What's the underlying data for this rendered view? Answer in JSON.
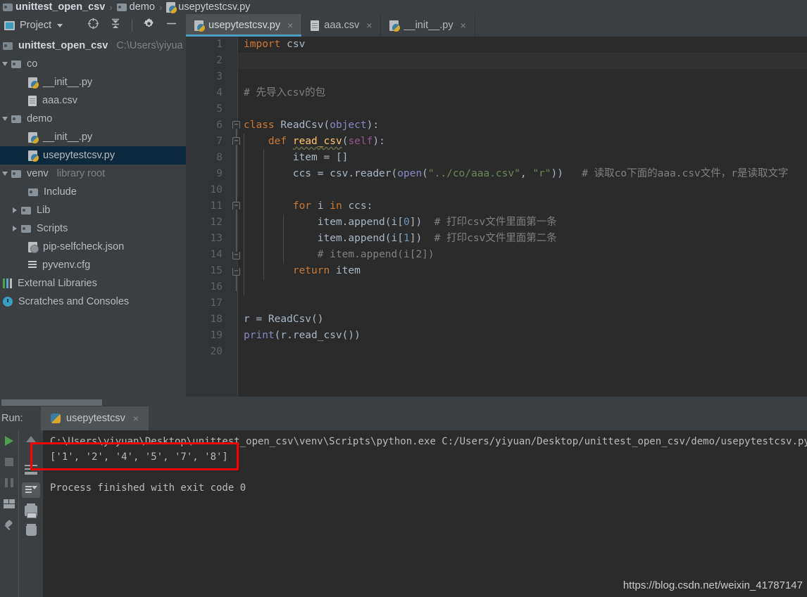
{
  "breadcrumb": {
    "items": [
      {
        "label": "unittest_open_csv",
        "icon": "folder-icon",
        "bold": true
      },
      {
        "label": "demo",
        "icon": "folder-icon",
        "bold": false
      },
      {
        "label": "usepytestcsv.py",
        "icon": "python-file-icon",
        "bold": false
      }
    ],
    "separator": "›"
  },
  "project_panel": {
    "title": "Project",
    "caret": "chevron-down-icon",
    "toolbar": [
      {
        "name": "locate-icon",
        "label": "Select Opened File"
      },
      {
        "name": "collapse-all-icon",
        "label": "Collapse All"
      },
      {
        "name": "gear-icon",
        "label": "Settings"
      },
      {
        "name": "hide-icon",
        "label": "Hide"
      }
    ],
    "tree": [
      {
        "label": "unittest_open_csv",
        "hint": "C:\\Users\\yiyua",
        "icon": "folder-icon",
        "depth": 0,
        "twisty": "",
        "bold": true,
        "selected": false
      },
      {
        "label": "co",
        "hint": "",
        "icon": "folder-icon",
        "depth": 1,
        "twisty": "down",
        "bold": false,
        "selected": false
      },
      {
        "label": "__init__.py",
        "hint": "",
        "icon": "python-file-icon",
        "depth": 2,
        "twisty": "",
        "bold": false,
        "selected": false
      },
      {
        "label": "aaa.csv",
        "hint": "",
        "icon": "csv-file-icon",
        "depth": 2,
        "twisty": "",
        "bold": false,
        "selected": false
      },
      {
        "label": "demo",
        "hint": "",
        "icon": "folder-icon",
        "depth": 1,
        "twisty": "down",
        "bold": false,
        "selected": false
      },
      {
        "label": "__init__.py",
        "hint": "",
        "icon": "python-file-icon",
        "depth": 2,
        "twisty": "",
        "bold": false,
        "selected": false
      },
      {
        "label": "usepytestcsv.py",
        "hint": "",
        "icon": "python-file-icon",
        "depth": 2,
        "twisty": "",
        "bold": false,
        "selected": true
      },
      {
        "label": "venv",
        "hint": "library root",
        "icon": "folder-icon",
        "depth": 1,
        "twisty": "down",
        "bold": false,
        "selected": false
      },
      {
        "label": "Include",
        "hint": "",
        "icon": "folder-icon",
        "depth": 2,
        "twisty": "",
        "bold": false,
        "selected": false
      },
      {
        "label": "Lib",
        "hint": "",
        "icon": "folder-icon",
        "depth": 2,
        "twisty": "right",
        "bold": false,
        "selected": false
      },
      {
        "label": "Scripts",
        "hint": "",
        "icon": "folder-icon",
        "depth": 2,
        "twisty": "right",
        "bold": false,
        "selected": false
      },
      {
        "label": "pip-selfcheck.json",
        "hint": "",
        "icon": "json-file-icon",
        "depth": 2,
        "twisty": "",
        "bold": false,
        "selected": false
      },
      {
        "label": "pyvenv.cfg",
        "hint": "",
        "icon": "cfg-file-icon",
        "depth": 2,
        "twisty": "",
        "bold": false,
        "selected": false
      },
      {
        "label": "External Libraries",
        "hint": "",
        "icon": "external-libraries-icon",
        "depth": 0,
        "twisty": "",
        "bold": false,
        "selected": false
      },
      {
        "label": "Scratches and Consoles",
        "hint": "",
        "icon": "scratches-icon",
        "depth": 0,
        "twisty": "",
        "bold": false,
        "selected": false
      }
    ]
  },
  "editor_tabs": [
    {
      "label": "usepytestcsv.py",
      "icon": "python-file-icon",
      "active": true,
      "close": "×"
    },
    {
      "label": "aaa.csv",
      "icon": "csv-file-icon",
      "active": false,
      "close": "×"
    },
    {
      "label": "__init__.py",
      "icon": "python-file-icon",
      "active": false,
      "close": "×"
    }
  ],
  "editor": {
    "line_numbers": [
      "1",
      "2",
      "3",
      "4",
      "5",
      "6",
      "7",
      "8",
      "9",
      "10",
      "11",
      "12",
      "13",
      "14",
      "15",
      "16",
      "17",
      "18",
      "19",
      "20"
    ],
    "lines": [
      {
        "n": 1,
        "text": "import csv"
      },
      {
        "n": 2,
        "text": ""
      },
      {
        "n": 3,
        "text": ""
      },
      {
        "n": 4,
        "text": "# 先导入csv的包"
      },
      {
        "n": 5,
        "text": ""
      },
      {
        "n": 6,
        "text": "class ReadCsv(object):"
      },
      {
        "n": 7,
        "text": "    def read_csv(self):"
      },
      {
        "n": 8,
        "text": "        item = []"
      },
      {
        "n": 9,
        "text": "        ccs = csv.reader(open(\"../co/aaa.csv\", \"r\"))   # 读取co下面的aaa.csv文件，r是读取文字"
      },
      {
        "n": 10,
        "text": ""
      },
      {
        "n": 11,
        "text": "        for i in ccs:"
      },
      {
        "n": 12,
        "text": "            item.append(i[0])  # 打印csv文件里面第一条"
      },
      {
        "n": 13,
        "text": "            item.append(i[1])  # 打印csv文件里面第二条"
      },
      {
        "n": 14,
        "text": "            # item.append(i[2])"
      },
      {
        "n": 15,
        "text": "        return item"
      },
      {
        "n": 16,
        "text": ""
      },
      {
        "n": 17,
        "text": ""
      },
      {
        "n": 18,
        "text": "r = ReadCsv()"
      },
      {
        "n": 19,
        "text": "print(r.read_csv())"
      },
      {
        "n": 20,
        "text": ""
      }
    ]
  },
  "run_panel": {
    "label": "Run:",
    "tab_label": "usepytestcsv",
    "tab_close": "×",
    "toolbar_left": [
      {
        "name": "rerun-icon",
        "label": "Rerun"
      },
      {
        "name": "stop-icon",
        "label": "Stop"
      },
      {
        "name": "pause-icon",
        "label": "Pause Output"
      },
      {
        "name": "layout-icon",
        "label": "Layout"
      },
      {
        "name": "pin-icon",
        "label": "Pin Tab"
      }
    ],
    "toolbar_right": [
      {
        "name": "up-arrow-icon",
        "label": "Up the Stack Trace"
      },
      {
        "name": "soft-wrap-icon",
        "label": "Soft-Wrap"
      },
      {
        "name": "scroll-to-end-icon",
        "label": "Scroll to End"
      },
      {
        "name": "print-icon",
        "label": "Print"
      },
      {
        "name": "trash-icon",
        "label": "Clear All"
      }
    ],
    "console_lines": [
      "C:\\Users\\yiyuan\\Desktop\\unittest_open_csv\\venv\\Scripts\\python.exe C:/Users/yiyuan/Desktop/unittest_open_csv/demo/usepytestcsv.py",
      "['1', '2', '4', '5', '7', '8']",
      "",
      "Process finished with exit code 0"
    ],
    "highlight_color": "#ff0000"
  },
  "watermark": "https://blog.csdn.net/weixin_41787147",
  "colors": {
    "background": "#3c3f41",
    "editor_bg": "#2b2b2b",
    "gutter_bg": "#313335",
    "selection": "#0d293e",
    "tab_active_underline": "#4a9ec4",
    "keyword": "#cc7832",
    "string": "#6a8759",
    "number": "#6897bb",
    "comment": "#808080",
    "function": "#ffc66d",
    "builtin": "#8888c6",
    "self": "#94558d",
    "run_green": "#4f9e4f"
  }
}
